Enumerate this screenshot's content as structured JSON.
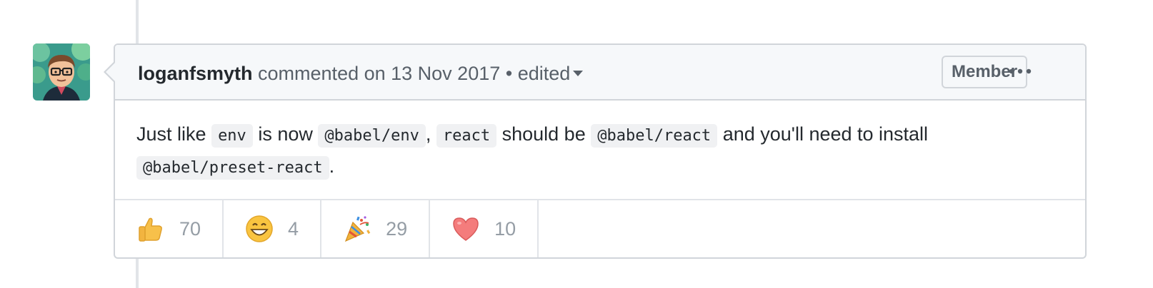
{
  "comment": {
    "author": "loganfsmyth",
    "action_text": "commented on 13 Nov 2017",
    "separator": "•",
    "edited_label": "edited",
    "role_badge": "Member",
    "more_icon": "kebab-horizontal-icon",
    "body": {
      "t1": "Just like",
      "c1": "env",
      "t2": "is now",
      "c2": "@babel/env",
      "t3": ",",
      "c3": "react",
      "t4": "should be",
      "c4": "@babel/react",
      "t5": "and you'll need to install",
      "c5": "@babel/preset-react",
      "t6": "."
    },
    "reactions": [
      {
        "emoji": "thumbs-up-icon",
        "count": "70"
      },
      {
        "emoji": "laugh-icon",
        "count": "4"
      },
      {
        "emoji": "party-popper-icon",
        "count": "29"
      },
      {
        "emoji": "heart-icon",
        "count": "10"
      }
    ]
  },
  "colors": {
    "border": "#d1d5da",
    "header_bg": "#f6f8fa",
    "muted_text": "#586069",
    "count_text": "#959da5"
  }
}
